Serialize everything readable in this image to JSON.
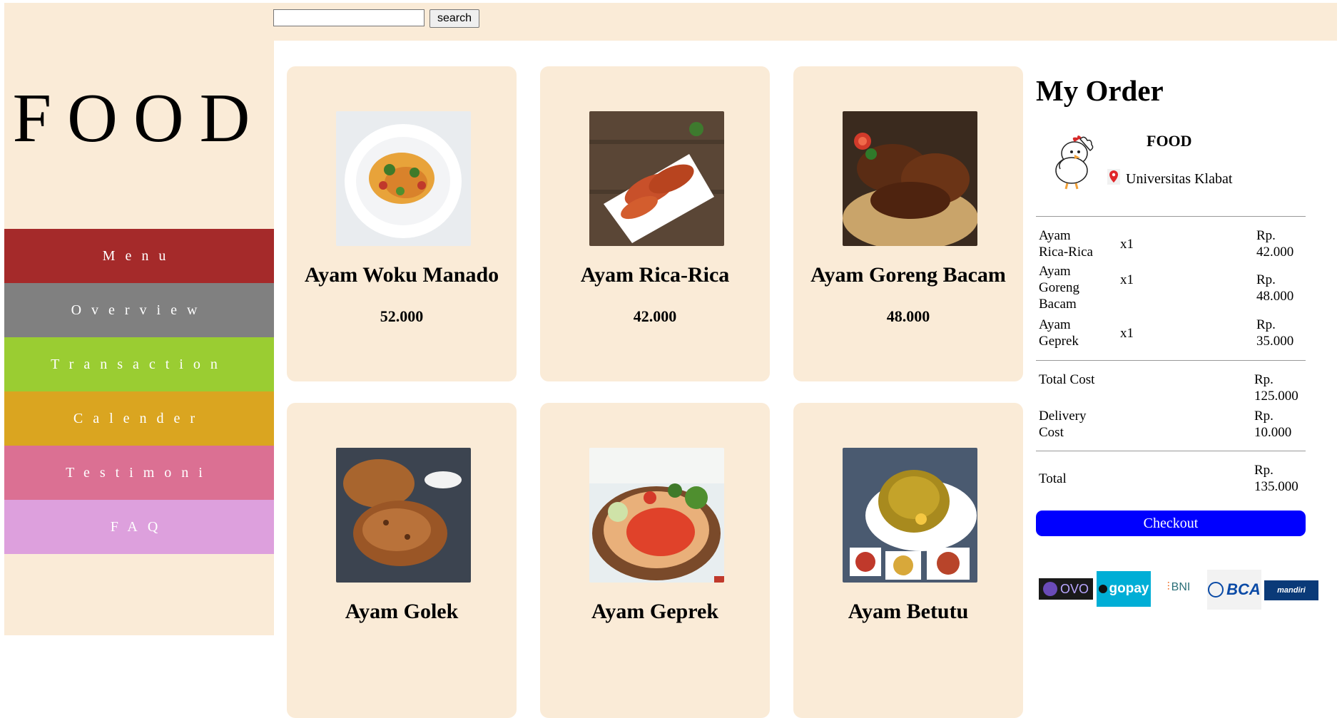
{
  "search": {
    "button_label": "search",
    "placeholder": "",
    "value": ""
  },
  "sidebar": {
    "brand": "FOOD",
    "items": [
      {
        "label": "Menu",
        "color": "#a52a2a"
      },
      {
        "label": "Overview",
        "color": "#808080"
      },
      {
        "label": "Transaction",
        "color": "#9acd32"
      },
      {
        "label": "Calender",
        "color": "#daa520"
      },
      {
        "label": "Testimoni",
        "color": "#db7093"
      },
      {
        "label": "FAQ",
        "color": "#dda0dd"
      }
    ]
  },
  "menu": {
    "items": [
      {
        "name": "Ayam Woku Manado",
        "price": "52.000"
      },
      {
        "name": "Ayam Rica-Rica",
        "price": "42.000"
      },
      {
        "name": "Ayam Goreng Bacam",
        "price": "48.000"
      },
      {
        "name": "Ayam Golek",
        "price": ""
      },
      {
        "name": "Ayam Geprek",
        "price": ""
      },
      {
        "name": "Ayam Betutu",
        "price": ""
      }
    ]
  },
  "order": {
    "title": "My Order",
    "shop_name": "FOOD",
    "location": "Universitas Klabat",
    "items": [
      {
        "name": "Ayam Rica-Rica",
        "qty": "x1",
        "price": "Rp. 42.000"
      },
      {
        "name": "Ayam Goreng Bacam",
        "qty": "x1",
        "price": "Rp. 48.000"
      },
      {
        "name": "Ayam Geprek",
        "qty": "x1",
        "price": "Rp. 35.000"
      }
    ],
    "total_cost_label": "Total Cost",
    "total_cost": "Rp. 125.000",
    "delivery_label": "Delivery Cost",
    "delivery_cost": "Rp. 10.000",
    "grand_total_label": "Total",
    "grand_total": "Rp. 135.000",
    "checkout_label": "Checkout",
    "checkout_color": "#0000ff"
  },
  "payments": {
    "ovo": "OVO",
    "gopay": "gopay",
    "bni": "BNI",
    "bca": "BCA",
    "mandiri": "mandiri"
  },
  "colors": {
    "panel": "#faebd7"
  }
}
